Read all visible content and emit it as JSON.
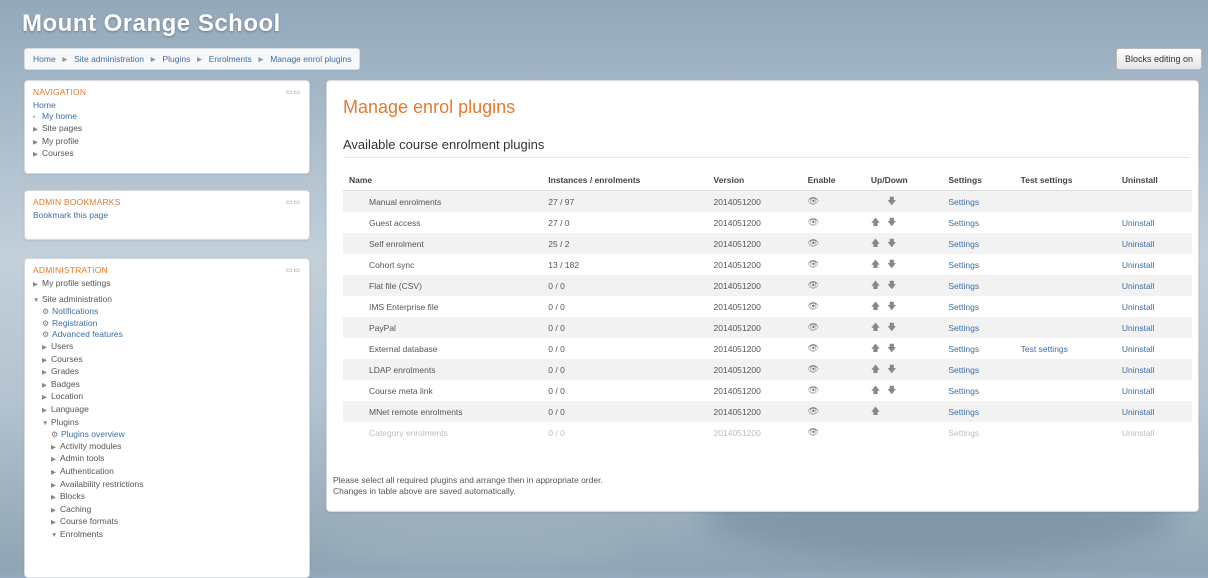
{
  "site": {
    "title": "Mount Orange School"
  },
  "breadcrumb": [
    "Home",
    "Site administration",
    "Plugins",
    "Enrolments",
    "Manage enrol plugins"
  ],
  "blocks_editing_label": "Blocks editing on",
  "navigation": {
    "title": "NAVIGATION",
    "home": "Home",
    "items": [
      "My home",
      "Site pages",
      "My profile",
      "Courses"
    ]
  },
  "bookmarks": {
    "title": "ADMIN BOOKMARKS",
    "link": "Bookmark this page"
  },
  "administration": {
    "title": "ADMINISTRATION",
    "my_profile": "My profile settings",
    "site_admin": "Site administration",
    "notifications": "Notifications",
    "registration": "Registration",
    "advanced_features": "Advanced features",
    "users": "Users",
    "courses": "Courses",
    "grades": "Grades",
    "badges": "Badges",
    "location": "Location",
    "language": "Language",
    "plugins": "Plugins",
    "plugins_overview": "Plugins overview",
    "plugin_items": [
      "Activity modules",
      "Admin tools",
      "Authentication",
      "Availability restrictions",
      "Blocks",
      "Caching",
      "Course formats"
    ],
    "enrolments": "Enrolments"
  },
  "main": {
    "title": "Manage enrol plugins",
    "section": "Available course enrolment plugins",
    "columns": [
      "Name",
      "Instances / enrolments",
      "Version",
      "Enable",
      "Up/Down",
      "Settings",
      "Test settings",
      "Uninstall"
    ],
    "rows": [
      {
        "name": "Manual enrolments",
        "instances": "27 / 97",
        "version": "2014051200",
        "up": false,
        "down": true,
        "settings": "Settings",
        "test": "",
        "uninstall": "",
        "enabled": true
      },
      {
        "name": "Guest access",
        "instances": "27 / 0",
        "version": "2014051200",
        "up": true,
        "down": true,
        "settings": "Settings",
        "test": "",
        "uninstall": "Uninstall",
        "enabled": true
      },
      {
        "name": "Self enrolment",
        "instances": "25 / 2",
        "version": "2014051200",
        "up": true,
        "down": true,
        "settings": "Settings",
        "test": "",
        "uninstall": "Uninstall",
        "enabled": true
      },
      {
        "name": "Cohort sync",
        "instances": "13 / 182",
        "version": "2014051200",
        "up": true,
        "down": true,
        "settings": "Settings",
        "test": "",
        "uninstall": "Uninstall",
        "enabled": true
      },
      {
        "name": "Flat file (CSV)",
        "instances": "0 / 0",
        "version": "2014051200",
        "up": true,
        "down": true,
        "settings": "Settings",
        "test": "",
        "uninstall": "Uninstall",
        "enabled": true
      },
      {
        "name": "IMS Enterprise file",
        "instances": "0 / 0",
        "version": "2014051200",
        "up": true,
        "down": true,
        "settings": "Settings",
        "test": "",
        "uninstall": "Uninstall",
        "enabled": true
      },
      {
        "name": "PayPal",
        "instances": "0 / 0",
        "version": "2014051200",
        "up": true,
        "down": true,
        "settings": "Settings",
        "test": "",
        "uninstall": "Uninstall",
        "enabled": true
      },
      {
        "name": "External database",
        "instances": "0 / 0",
        "version": "2014051200",
        "up": true,
        "down": true,
        "settings": "Settings",
        "test": "Test settings",
        "uninstall": "Uninstall",
        "enabled": true
      },
      {
        "name": "LDAP enrolments",
        "instances": "0 / 0",
        "version": "2014051200",
        "up": true,
        "down": true,
        "settings": "Settings",
        "test": "",
        "uninstall": "Uninstall",
        "enabled": true
      },
      {
        "name": "Course meta link",
        "instances": "0 / 0",
        "version": "2014051200",
        "up": true,
        "down": true,
        "settings": "Settings",
        "test": "",
        "uninstall": "Uninstall",
        "enabled": true
      },
      {
        "name": "MNet remote enrolments",
        "instances": "0 / 0",
        "version": "2014051200",
        "up": true,
        "down": false,
        "settings": "Settings",
        "test": "",
        "uninstall": "Uninstall",
        "enabled": true
      },
      {
        "name": "Category enrolments",
        "instances": "0 / 0",
        "version": "2014051200",
        "up": false,
        "down": false,
        "settings": "Settings",
        "test": "",
        "uninstall": "Uninstall",
        "enabled": false
      }
    ],
    "notes": [
      "Please select all required plugins and arrange then in appropriate order.",
      "Changes in table above are saved automatically."
    ]
  },
  "icons": {
    "enable": "eye-icon",
    "up": "arrow-up-icon",
    "down": "arrow-down-icon",
    "gear": "gear-icon",
    "expand": "triangle-right-icon",
    "collapse": "triangle-down-icon"
  },
  "colors": {
    "accent": "#e47a2e",
    "link": "#3d6fa3",
    "row_stripe": "#f2f2f2"
  }
}
